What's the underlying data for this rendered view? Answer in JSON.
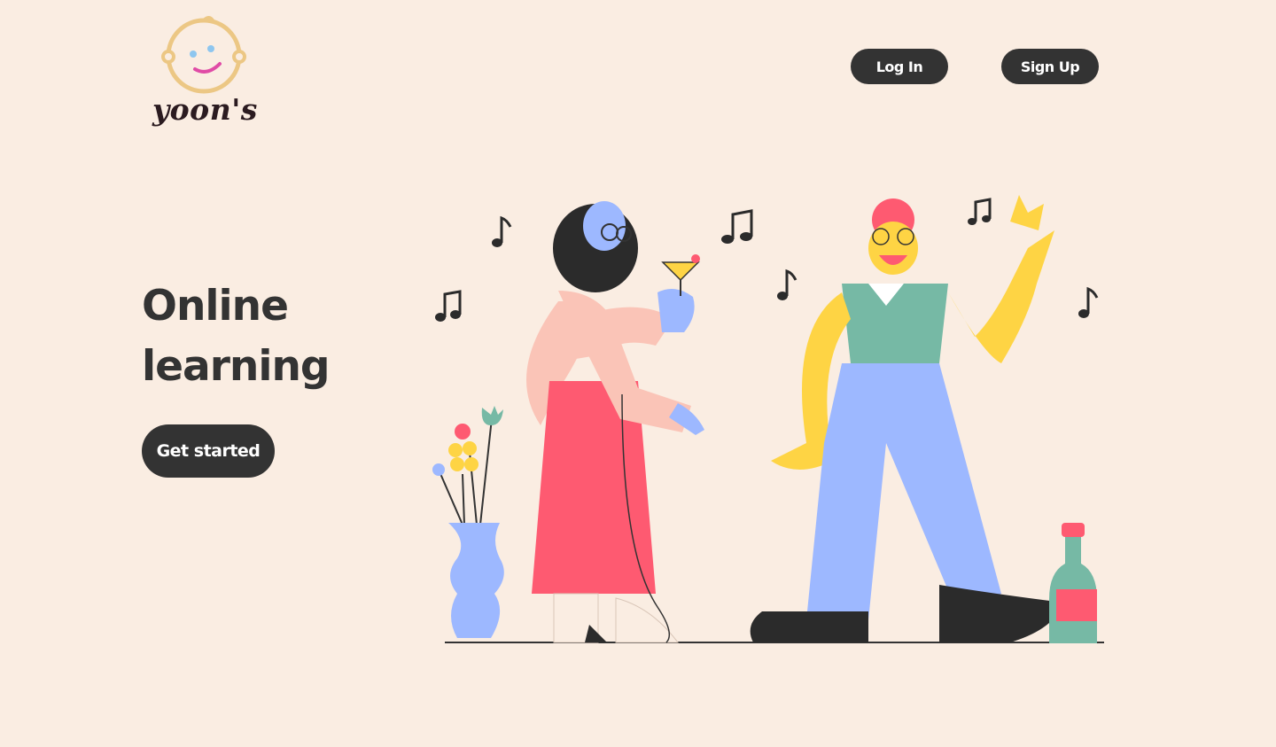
{
  "brand": {
    "name": "yoon's",
    "logo_icon": "smiling-baby-face-icon"
  },
  "header": {
    "login_label": "Log In",
    "signup_label": "Sign Up"
  },
  "hero": {
    "headline_line1": "Online",
    "headline_line2": "learning",
    "cta_label": "Get started",
    "illustration": "dancing-couple-illustration"
  },
  "colors": {
    "background": "#faede2",
    "button": "#333333",
    "button_text": "#ffffff",
    "heading": "#333333",
    "logo_face": "#f1d18b"
  }
}
